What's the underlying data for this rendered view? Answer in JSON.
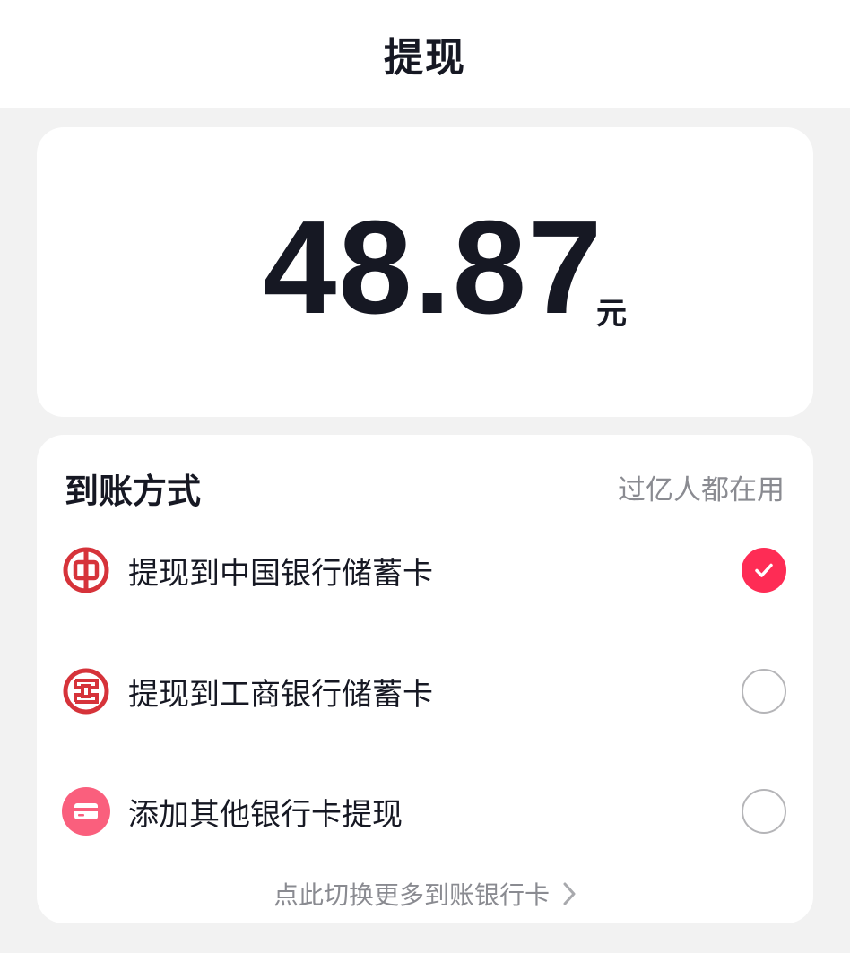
{
  "header": {
    "title": "提现"
  },
  "amount": {
    "value": "48.87",
    "unit": "元"
  },
  "payout": {
    "title": "到账方式",
    "hint": "过亿人都在用",
    "options": [
      {
        "label": "提现到中国银行储蓄卡",
        "icon": "bank-of-china-icon",
        "selected": true
      },
      {
        "label": "提现到工商银行储蓄卡",
        "icon": "icbc-bank-icon",
        "selected": false
      },
      {
        "label": "添加其他银行卡提现",
        "icon": "credit-card-icon",
        "selected": false
      }
    ],
    "more_link": "点此切换更多到账银行卡"
  },
  "colors": {
    "accent": "#fe2c55",
    "bank_red": "#d6333a",
    "card_icon": "#fa5f7d",
    "text_primary": "#161823",
    "text_secondary": "#8a8b91",
    "background": "#f2f2f2"
  }
}
